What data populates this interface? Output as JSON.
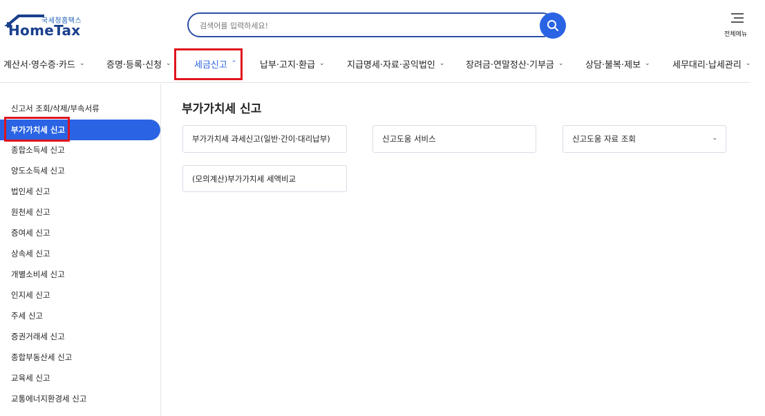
{
  "header": {
    "logo_sub": "국세청홈택스",
    "logo_main": "HomeTax",
    "search_placeholder": "검색어를 입력하세요!",
    "all_menu_label": "전체메뉴"
  },
  "nav": {
    "items": [
      {
        "label": "계산서·영수증·카드"
      },
      {
        "label": "증명·등록·신청"
      },
      {
        "label": "세금신고",
        "active": true
      },
      {
        "label": "납부·고지·환급"
      },
      {
        "label": "지급명세·자료·공익법인"
      },
      {
        "label": "장려금·연말정산·기부금"
      },
      {
        "label": "상담·불복·제보"
      },
      {
        "label": "세무대리·납세관리"
      }
    ]
  },
  "sidebar": {
    "items": [
      {
        "label": "신고서 조회/삭제/부속서류"
      },
      {
        "label": "부가가치세 신고",
        "active": true
      },
      {
        "label": "종합소득세 신고"
      },
      {
        "label": "양도소득세 신고"
      },
      {
        "label": "법인세 신고"
      },
      {
        "label": "원천세 신고"
      },
      {
        "label": "증여세 신고"
      },
      {
        "label": "상속세 신고"
      },
      {
        "label": "개별소비세 신고"
      },
      {
        "label": "인지세 신고"
      },
      {
        "label": "주세 신고"
      },
      {
        "label": "증권거래세 신고"
      },
      {
        "label": "종합부동산세 신고"
      },
      {
        "label": "교육세 신고"
      },
      {
        "label": "교통에너지환경세 신고"
      }
    ]
  },
  "main": {
    "title": "부가가치세 신고",
    "cards": [
      {
        "label": "부가가치세 과세신고(일반·간이·대리납부)"
      },
      {
        "label": "신고도움 서비스"
      },
      {
        "label": "신고도움 자료 조회",
        "has_dropdown": true
      },
      {
        "label": "(모의계산)부가가치세 세액비교"
      }
    ]
  },
  "colors": {
    "accent": "#2a64e4",
    "highlight_box": "#e0141e",
    "logo_blue": "#1a3f8c"
  }
}
